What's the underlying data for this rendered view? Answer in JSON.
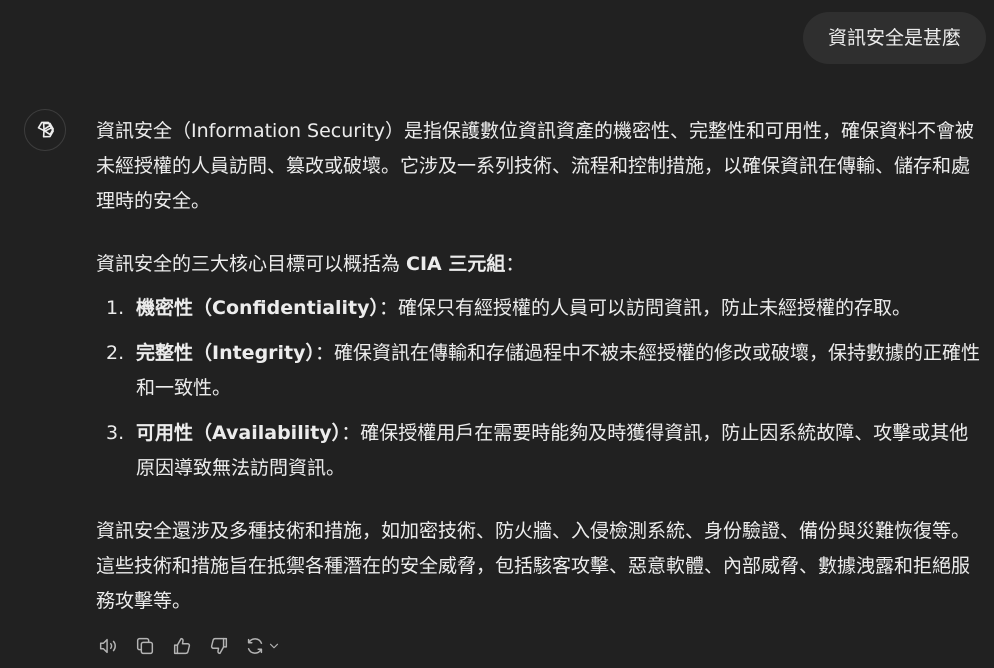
{
  "user_message": "資訊安全是甚麼",
  "answer": {
    "intro_1": "資訊安全（Information Security）是指保護數位資訊資產的機密性、完整性和可用性，確保資料不會被未經授權的人員訪問、篡改或破壞。它涉及一系列技術、流程和控制措施，以確保資訊在傳輸、儲存和處理時的安全。",
    "intro_2_prefix": "資訊安全的三大核心目標可以概括為 ",
    "intro_2_bold": "CIA 三元組",
    "intro_2_suffix": "：",
    "goals": [
      {
        "number": "1.",
        "title": "機密性（Confidentiality）",
        "text": "：確保只有經授權的人員可以訪問資訊，防止未經授權的存取。"
      },
      {
        "number": "2.",
        "title": "完整性（Integrity）",
        "text": "：確保資訊在傳輸和存儲過程中不被未經授權的修改或破壞，保持數據的正確性和一致性。"
      },
      {
        "number": "3.",
        "title": "可用性（Availability）",
        "text": "：確保授權用戶在需要時能夠及時獲得資訊，防止因系統故障、攻擊或其他原因導致無法訪問資訊。"
      }
    ],
    "closing": "資訊安全還涉及多種技術和措施，如加密技術、防火牆、入侵檢測系統、身份驗證、備份與災難恢復等。這些技術和措施旨在抵禦各種潛在的安全威脅，包括駭客攻擊、惡意軟體、內部威脅、數據洩露和拒絕服務攻擊等。"
  },
  "actions": {
    "icons": [
      "speaker-icon",
      "copy-icon",
      "thumbs-up-icon",
      "thumbs-down-icon",
      "regenerate-icon",
      "chevron-down-icon"
    ]
  },
  "colors": {
    "background": "#212121",
    "user_bubble": "#2f2f2f",
    "text": "#ececec",
    "icon": "#b4b4b4"
  }
}
